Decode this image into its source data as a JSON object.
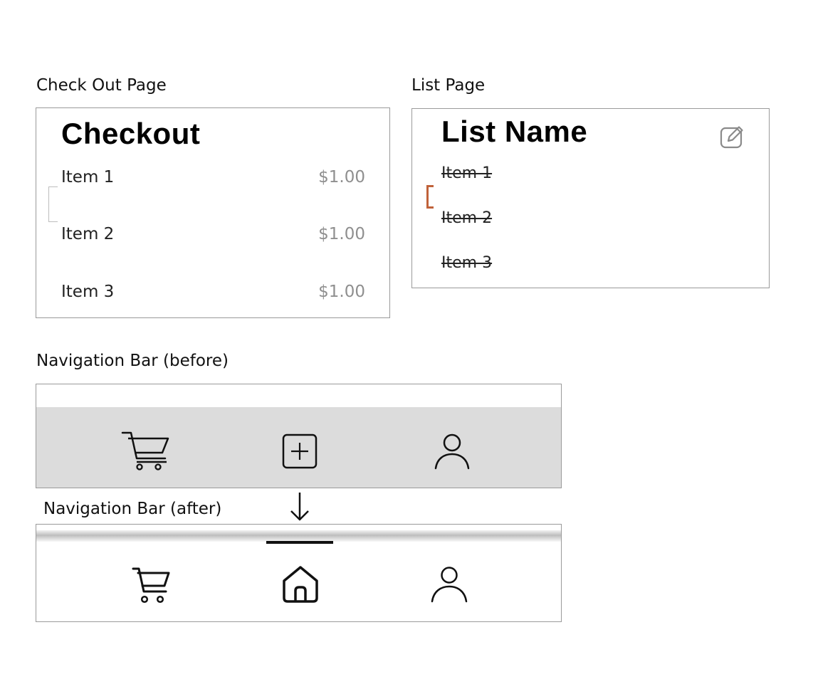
{
  "labels": {
    "checkout_page": "Check Out Page",
    "list_page": "List Page",
    "nav_before": "Navigation Bar (before)",
    "nav_after": "Navigation Bar (after)"
  },
  "checkout": {
    "title": "Checkout",
    "items": [
      {
        "name": "Item 1",
        "price": "$1.00"
      },
      {
        "name": "Item 2",
        "price": "$1.00"
      },
      {
        "name": "Item 3",
        "price": "$1.00"
      }
    ]
  },
  "list": {
    "title": "List Name",
    "items": [
      "Item 1",
      "Item 2",
      "Item 3"
    ],
    "edit_icon": "edit-icon"
  },
  "nav_before": {
    "icons": [
      "cart-icon",
      "add-square-icon",
      "profile-icon"
    ],
    "band_color": "#dcdcdc"
  },
  "nav_after": {
    "icons": [
      "cart-icon",
      "home-icon",
      "profile-icon"
    ],
    "active": "home-icon"
  },
  "colors": {
    "bracket_accent": "#c0623a",
    "price_gray": "#8f8f8f"
  }
}
